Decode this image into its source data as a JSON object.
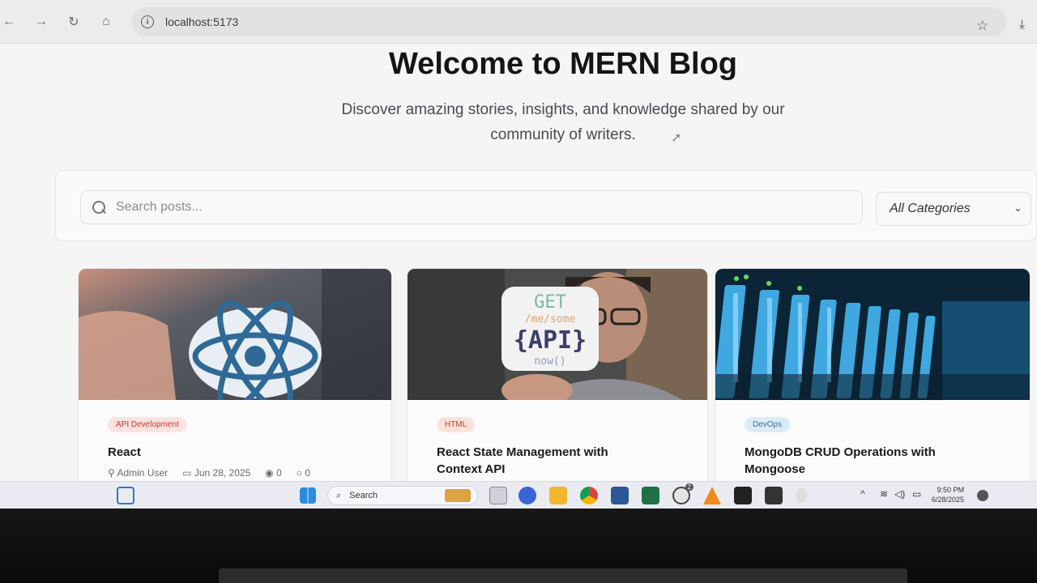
{
  "browser": {
    "url": "localhost:5173"
  },
  "hero": {
    "title": "Welcome to MERN Blog",
    "subtitle_line1": "Discover amazing stories, insights, and knowledge shared by our",
    "subtitle_line2": "community of writers."
  },
  "filters": {
    "search_placeholder": "Search posts...",
    "category_selected": "All Categories"
  },
  "posts": [
    {
      "tag": "API Development",
      "tag_color": "#fde2e2",
      "tag_text_color": "#c0392b",
      "title": "React",
      "author": "Admin User",
      "date": "Jun 28, 2025",
      "views": "0",
      "comments": "0"
    },
    {
      "tag": "HTML",
      "tag_color": "#fbe3dc",
      "tag_text_color": "#b4411f",
      "title_line1": "React State Management with",
      "title_line2": "Context API",
      "sticker": {
        "l1": "GET",
        "l2": "/me/some",
        "l3": "{API}",
        "l4": "now()"
      }
    },
    {
      "tag": "DevOps",
      "tag_color": "#dcebf7",
      "tag_text_color": "#3b6f99",
      "title_line1": "MongoDB CRUD Operations with",
      "title_line2": "Mongoose"
    }
  ],
  "taskbar": {
    "search_label": "Search",
    "time": "9:50 PM",
    "date": "6/28/2025",
    "whatsapp_badge": "2"
  }
}
